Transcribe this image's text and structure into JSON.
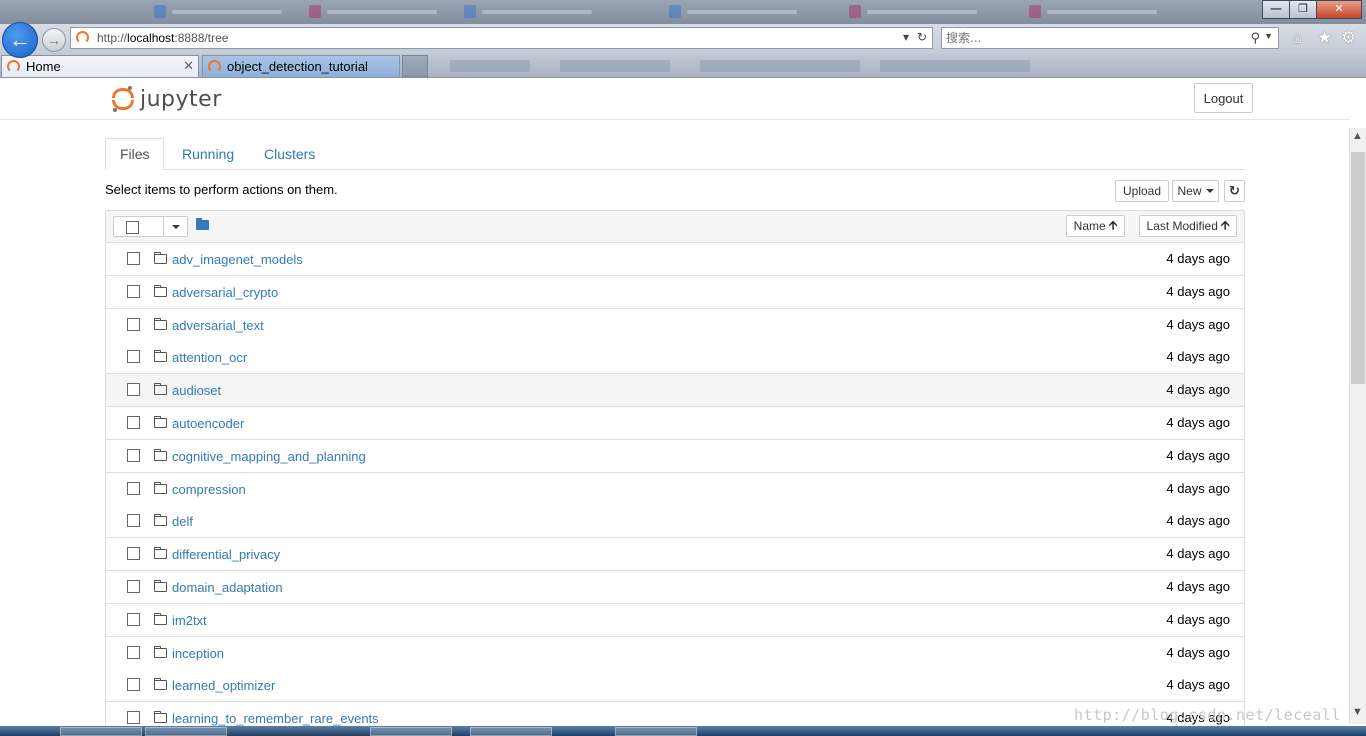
{
  "browser": {
    "url_prefix": "http://",
    "url_host": "localhost",
    "url_rest": ":8888/tree",
    "search_placeholder": "搜索...",
    "tabs": [
      {
        "label": "Home",
        "active": true
      },
      {
        "label": "object_detection_tutorial",
        "active": false
      }
    ]
  },
  "header": {
    "logo_text": "jupyter",
    "logout_label": "Logout"
  },
  "nav_tabs": [
    {
      "label": "Files",
      "active": true
    },
    {
      "label": "Running",
      "active": false
    },
    {
      "label": "Clusters",
      "active": false
    }
  ],
  "toolbar": {
    "instructions": "Select items to perform actions on them.",
    "upload_label": "Upload",
    "new_label": "New"
  },
  "list_header": {
    "sort_name_label": "Name",
    "sort_modified_label": "Last Modified"
  },
  "files": [
    {
      "name": "adv_imagenet_models",
      "modified": "4 days ago"
    },
    {
      "name": "adversarial_crypto",
      "modified": "4 days ago"
    },
    {
      "name": "adversarial_text",
      "modified": "4 days ago"
    },
    {
      "name": "attention_ocr",
      "modified": "4 days ago"
    },
    {
      "name": "audioset",
      "modified": "4 days ago"
    },
    {
      "name": "autoencoder",
      "modified": "4 days ago"
    },
    {
      "name": "cognitive_mapping_and_planning",
      "modified": "4 days ago"
    },
    {
      "name": "compression",
      "modified": "4 days ago"
    },
    {
      "name": "delf",
      "modified": "4 days ago"
    },
    {
      "name": "differential_privacy",
      "modified": "4 days ago"
    },
    {
      "name": "domain_adaptation",
      "modified": "4 days ago"
    },
    {
      "name": "im2txt",
      "modified": "4 days ago"
    },
    {
      "name": "inception",
      "modified": "4 days ago"
    },
    {
      "name": "learned_optimizer",
      "modified": "4 days ago"
    },
    {
      "name": "learning_to_remember_rare_events",
      "modified": "4 days ago"
    }
  ],
  "watermark": "http://blog.csdn.net/leceall",
  "colors": {
    "link": "#337ab7",
    "brand_orange": "#f37726",
    "border": "#dddddd"
  }
}
